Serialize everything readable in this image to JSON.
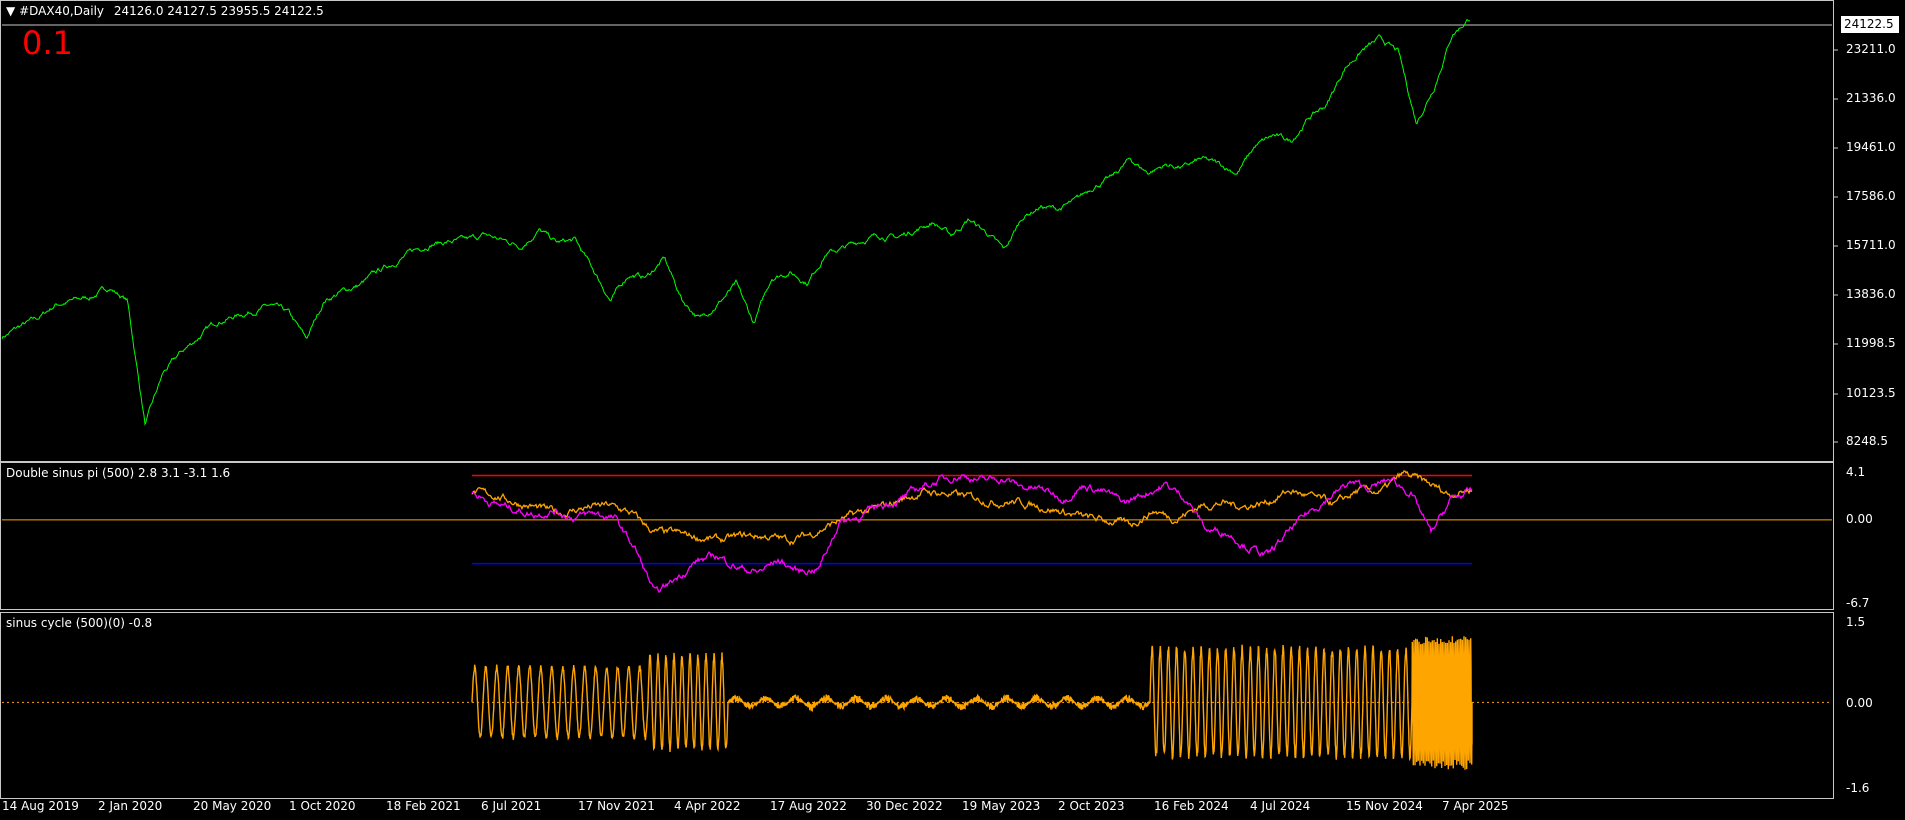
{
  "header": {
    "symbol": "#DAX40,Daily",
    "ohlc": "24126.0 24127.5 23955.5 24122.5",
    "big_value": "0.1",
    "last_price": "24122.5"
  },
  "price_axis": [
    "23211.0",
    "21336.0",
    "19461.0",
    "17586.0",
    "15711.0",
    "13836.0",
    "11998.5",
    "10123.5",
    "8248.5"
  ],
  "osc1": {
    "title": "Double sinus pi (500) 2.8 3.1 -3.1 1.6",
    "axis": [
      "4.1",
      "0.00",
      "-6.7"
    ]
  },
  "osc2": {
    "title": "sinus cycle (500)(0) -0.8",
    "axis": [
      "1.5",
      "0.00",
      "-1.6"
    ]
  },
  "date_axis": [
    "14 Aug 2019",
    "2 Jan 2020",
    "20 May 2020",
    "1 Oct 2020",
    "18 Feb 2021",
    "6 Jul 2021",
    "17 Nov 2021",
    "4 Apr 2022",
    "17 Aug 2022",
    "30 Dec 2022",
    "19 May 2023",
    "2 Oct 2023",
    "16 Feb 2024",
    "4 Jul 2024",
    "15 Nov 2024",
    "7 Apr 2025"
  ],
  "colors": {
    "price": "#00ff00",
    "orange": "#ffa500",
    "magenta": "#ff00ff",
    "upper_level": "#ff0000",
    "lower_level": "#0000ff",
    "zero_line": "#ffa500",
    "border": "#c8c8c8"
  },
  "chart_data": [
    {
      "type": "line",
      "title": "#DAX40,Daily",
      "series": [
        {
          "values": [
            11900,
            12300,
            12600,
            13150,
            13300,
            13450,
            13800,
            13300,
            8550,
            10500,
            11300,
            11900,
            12500,
            12700,
            12900,
            13100,
            12800,
            11800,
            13300,
            13650,
            13900,
            14400,
            14800,
            15200,
            15500,
            15550,
            15600,
            15800,
            15600,
            15400,
            16000,
            15500,
            15600,
            14500,
            13300,
            14300,
            14200,
            14900,
            13300,
            12600,
            13200,
            13900,
            12400,
            14200,
            14400,
            14000,
            15100,
            15300,
            15600,
            15800,
            15700,
            16000,
            16300,
            15800,
            16400,
            15900,
            15200,
            16500,
            16900,
            16800,
            17100,
            17700,
            18000,
            18700,
            18200,
            18500,
            18400,
            18700,
            18500,
            18200,
            19200,
            19600,
            19400,
            20300,
            20800,
            22200,
            22900,
            23300,
            22800,
            20100,
            21500,
            23500,
            24122.5
          ],
          "color": "#00ff00"
        }
      ],
      "ylim": [
        7500,
        24500
      ],
      "yticks": [
        "23211.0",
        "21336.0",
        "19461.0",
        "17586.0",
        "15711.0",
        "13836.0",
        "11998.5",
        "10123.5",
        "8248.5"
      ],
      "grid": false
    },
    {
      "type": "line",
      "title": "Double sinus pi (500) 2.8 3.1 -3.1 1.6",
      "series": [
        {
          "values": [
            2.4,
            2.2,
            1.5,
            1.0,
            0.6,
            1.1,
            1.3,
            0.6,
            -1.1,
            -1.2,
            -1.6,
            -1.8,
            -1.4,
            -1.5,
            -1.8,
            -1.2,
            -0.2,
            0.6,
            1.1,
            1.9,
            2.5,
            2.3,
            2.0,
            1.6,
            1.6,
            1.2,
            0.7,
            0.2,
            -0.1,
            -0.4,
            0.8,
            0.1,
            1.2,
            1.5,
            1.2,
            1.6,
            2.6,
            2.0,
            1.4,
            2.6,
            2.5,
            4.1,
            3.3,
            2.3,
            2.8
          ],
          "color": "#ffa500"
        },
        {
          "values": [
            2.4,
            1.5,
            1.0,
            0.5,
            0.8,
            0.2,
            0.6,
            0.1,
            -2.6,
            -6.7,
            -5.2,
            -3.7,
            -3.2,
            -4.2,
            -4.7,
            -3.6,
            -4.6,
            -4.3,
            -0.2,
            0.3,
            1.3,
            1.8,
            2.9,
            3.6,
            4.0,
            3.5,
            3.7,
            2.9,
            2.7,
            1.9,
            3.1,
            2.5,
            1.5,
            2.4,
            3.1,
            1.9,
            -0.9,
            -1.1,
            -2.4,
            -3.2,
            -1.1,
            0.7,
            2.0,
            3.3,
            2.8,
            3.6,
            2.4,
            -1.2,
            1.9,
            2.5
          ],
          "color": "#ff00ff"
        }
      ],
      "levels": [
        3.95,
        0.0,
        -3.9
      ],
      "ylim": [
        -7.5,
        4.8
      ],
      "yticks": [
        "4.1",
        "0.00",
        "-6.7"
      ]
    },
    {
      "type": "line",
      "title": "sinus cycle (500)(0) -0.8",
      "series": [
        {
          "segments": [
            {
              "from": "6 Jul 2021",
              "cycles": 16,
              "amplitude": 0.72
            },
            {
              "from": "4 Apr 2022",
              "cycles": 10,
              "amplitude": 0.95
            },
            {
              "from": "17 Aug 2022",
              "cycles": 0,
              "amplitude": 0.15
            },
            {
              "from": "16 Feb 2024",
              "cycles": 32,
              "amplitude": 1.1
            },
            {
              "from": "15 Nov 2024",
              "cycles": 36,
              "amplitude": 1.35
            }
          ],
          "last_value": -0.8,
          "color": "#ffa500"
        }
      ],
      "zero_line": 0.0,
      "ylim": [
        -1.7,
        1.6
      ],
      "yticks": [
        "1.5",
        "0.00",
        "-1.6"
      ]
    }
  ]
}
